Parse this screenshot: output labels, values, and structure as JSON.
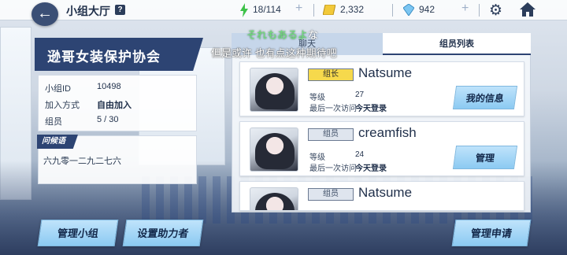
{
  "topbar": {
    "title": "小组大厅",
    "help": "?",
    "ap": "18/114",
    "credits": "2,332",
    "gems": "942"
  },
  "club": {
    "name": "逊哥女装保护协会",
    "rows": [
      {
        "label": "小组ID",
        "value": "10498"
      },
      {
        "label": "加入方式",
        "value": "自由加入"
      },
      {
        "label": "组员",
        "value": "5 / 30"
      }
    ],
    "greeting_tag": "问候语",
    "greeting": "六九零一二九二七六"
  },
  "tabs": {
    "chat": "聊天",
    "members": "组员列表"
  },
  "overlay": {
    "line1_green": "それもあるよ",
    "line1_white": "な",
    "line2": "但是或许 也有点这种期待吧"
  },
  "members": [
    {
      "role": "组长",
      "name": "Natsume",
      "level_label": "等级",
      "level": "27",
      "visit_label": "最后一次访问",
      "visit": "今天登录",
      "button": "我的信息"
    },
    {
      "role": "组员",
      "name": "creamfish",
      "level_label": "等级",
      "level": "24",
      "visit_label": "最后一次访问",
      "visit": "今天登录",
      "button": "管理"
    },
    {
      "role": "组员",
      "name": "Natsume"
    }
  ],
  "bottom": {
    "manage_group": "管理小组",
    "set_helper": "设置助力者",
    "manage_requests": "管理申请"
  },
  "colors": {
    "accent_dark": "#2d4473",
    "button_blue": "#8ccaf2",
    "leader_badge": "#f6d94c"
  }
}
